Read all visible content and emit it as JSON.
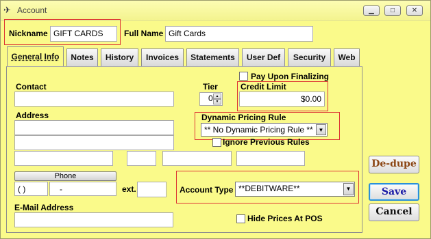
{
  "window": {
    "title": "Account",
    "minimize_label": "▭",
    "maximize_label": "□",
    "close_label": "✕"
  },
  "header": {
    "nickname_label": "Nickname",
    "nickname_value": "GIFT CARDS",
    "fullname_label": "Full Name",
    "fullname_value": "Gift Cards"
  },
  "tabs": [
    {
      "label": "General Info",
      "active": true
    },
    {
      "label": "Notes"
    },
    {
      "label": "History"
    },
    {
      "label": "Invoices"
    },
    {
      "label": "Statements"
    },
    {
      "label": "User Def"
    },
    {
      "label": "Security"
    },
    {
      "label": "Web"
    }
  ],
  "general": {
    "pay_upon_finalizing_label": "Pay Upon Finalizing",
    "contact_label": "Contact",
    "contact_value": "",
    "tier_label": "Tier",
    "tier_value": "0",
    "credit_limit_label": "Credit Limit",
    "credit_limit_value": "$0.00",
    "address_label": "Address",
    "dynamic_pricing_label": "Dynamic Pricing Rule",
    "dynamic_pricing_value": "** No Dynamic Pricing Rule **",
    "ignore_previous_label": "Ignore Previous Rules",
    "phone_button_label": "Phone",
    "phone_area_value": "(   )",
    "phone_number_value": "-",
    "ext_label": "ext.",
    "ext_value": "",
    "account_type_label": "Account Type",
    "account_type_value": "**DEBITWARE**",
    "email_label": "E-Mail Address",
    "email_value": "",
    "hide_prices_label": "Hide Prices At POS"
  },
  "actions": {
    "dedupe_label": "De-dupe",
    "save_label": "Save",
    "cancel_label": "Cancel"
  },
  "colors": {
    "window_bg": "#fafa8a",
    "highlight_border": "#dd3333",
    "dedupe_text": "#8b4513",
    "save_text": "#1a1aa6"
  }
}
